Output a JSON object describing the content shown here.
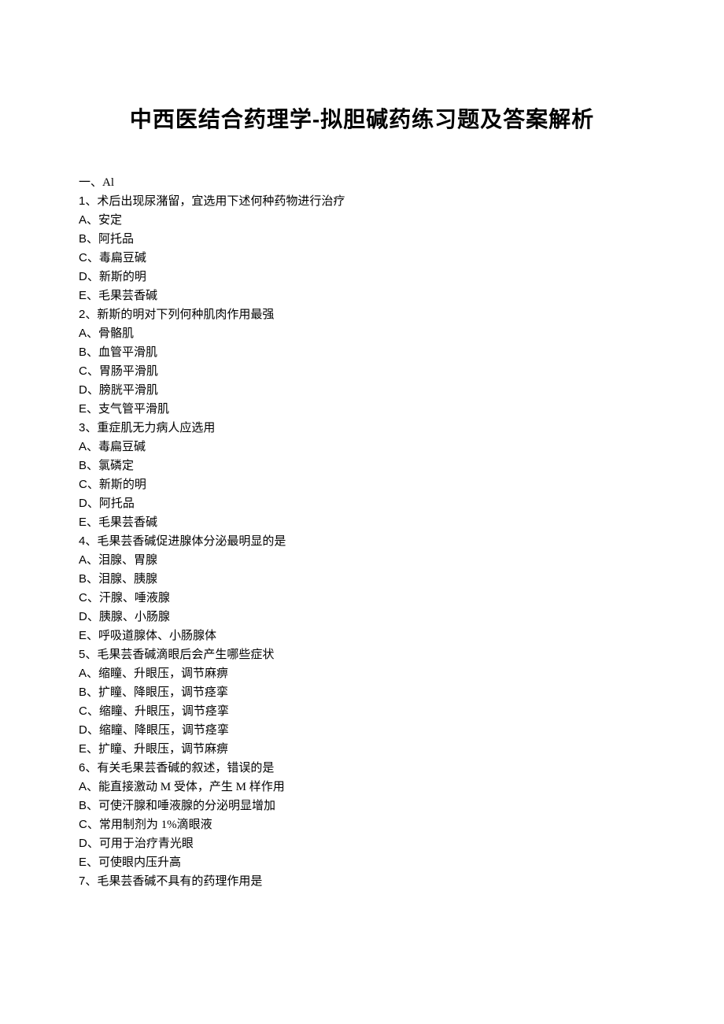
{
  "title": "中西医结合药理学-拟胆碱药练习题及答案解析",
  "section_label": "一、Al",
  "questions": [
    {
      "num": "1",
      "text": "术后出现尿潴留，宜选用下述何种药物进行治疗",
      "options": [
        {
          "letter": "A",
          "text": "安定"
        },
        {
          "letter": "B",
          "text": "阿托品"
        },
        {
          "letter": "C",
          "text": "毒扁豆碱"
        },
        {
          "letter": "D",
          "text": "新斯的明"
        },
        {
          "letter": "E",
          "text": "毛果芸香碱"
        }
      ]
    },
    {
      "num": "2",
      "text": "新斯的明对下列何种肌肉作用最强",
      "options": [
        {
          "letter": "A",
          "text": "骨骼肌"
        },
        {
          "letter": "B",
          "text": "血管平滑肌"
        },
        {
          "letter": "C",
          "text": "胃肠平滑肌"
        },
        {
          "letter": "D",
          "text": "膀胱平滑肌"
        },
        {
          "letter": "E",
          "text": "支气管平滑肌"
        }
      ]
    },
    {
      "num": "3",
      "text": "重症肌无力病人应选用",
      "options": [
        {
          "letter": "A",
          "text": "毒扁豆碱"
        },
        {
          "letter": "B",
          "text": "氯磷定"
        },
        {
          "letter": "C",
          "text": "新斯的明"
        },
        {
          "letter": "D",
          "text": "阿托品"
        },
        {
          "letter": "E",
          "text": "毛果芸香碱"
        }
      ]
    },
    {
      "num": "4",
      "text": "毛果芸香碱促进腺体分泌最明显的是",
      "options": [
        {
          "letter": "A",
          "text": "泪腺、胃腺"
        },
        {
          "letter": "B",
          "text": "泪腺、胰腺"
        },
        {
          "letter": "C",
          "text": "汗腺、唾液腺"
        },
        {
          "letter": "D",
          "text": "胰腺、小肠腺"
        },
        {
          "letter": "E",
          "text": "呼吸道腺体、小肠腺体"
        }
      ]
    },
    {
      "num": "5",
      "text": "毛果芸香碱滴眼后会产生哪些症状",
      "options": [
        {
          "letter": "A",
          "text": "缩瞳、升眼压，调节麻痹"
        },
        {
          "letter": "B",
          "text": "扩瞳、降眼压，调节痉挛"
        },
        {
          "letter": "C",
          "text": "缩瞳、升眼压，调节痉挛"
        },
        {
          "letter": "D",
          "text": "缩瞳、降眼压，调节痉挛"
        },
        {
          "letter": "E",
          "text": "扩瞳、升眼压，调节麻痹"
        }
      ]
    },
    {
      "num": "6",
      "text": "有关毛果芸香碱的叙述，错误的是",
      "options": [
        {
          "letter": "A",
          "text": "能直接激动 M 受体，产生 M 样作用"
        },
        {
          "letter": "B",
          "text": "可使汗腺和唾液腺的分泌明显增加"
        },
        {
          "letter": "C",
          "text": "常用制剂为 1%滴眼液"
        },
        {
          "letter": "D",
          "text": "可用于治疗青光眼"
        },
        {
          "letter": "E",
          "text": "可使眼内压升高"
        }
      ]
    },
    {
      "num": "7",
      "text": "毛果芸香碱不具有的药理作用是",
      "options": []
    }
  ]
}
